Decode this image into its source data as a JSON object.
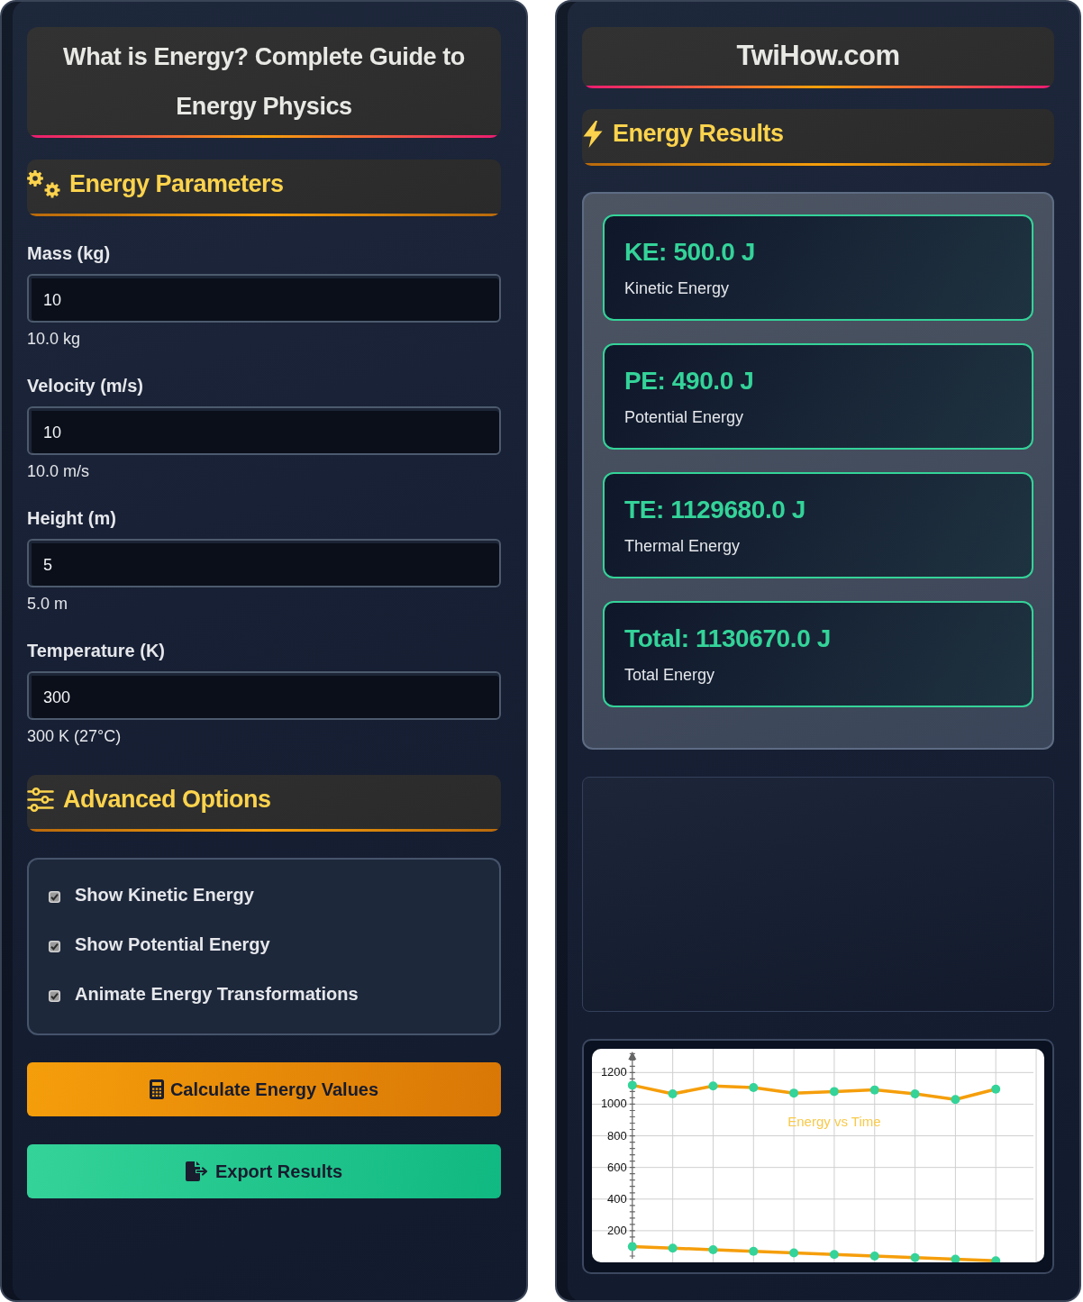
{
  "left_panel": {
    "title": "What is Energy? Complete Guide to Energy Physics",
    "parameters": {
      "heading": "Energy Parameters",
      "fields": [
        {
          "label": "Mass (kg)",
          "value": "10",
          "reading": "10.0 kg"
        },
        {
          "label": "Velocity (m/s)",
          "value": "10",
          "reading": "10.0 m/s"
        },
        {
          "label": "Height (m)",
          "value": "5",
          "reading": "5.0 m"
        },
        {
          "label": "Temperature (K)",
          "value": "300",
          "reading": "300 K (27°C)"
        }
      ]
    },
    "options": {
      "heading": "Advanced Options",
      "items": [
        {
          "label": "Show Kinetic Energy",
          "checked": true
        },
        {
          "label": "Show Potential Energy",
          "checked": true
        },
        {
          "label": "Animate Energy Transformations",
          "checked": true
        }
      ]
    },
    "buttons": [
      {
        "kind": "calculate",
        "label": "Calculate Energy Values"
      },
      {
        "kind": "export",
        "label": "Export Results"
      }
    ]
  },
  "right_panel": {
    "site_name": "TwiHow.com",
    "results": {
      "heading": "Energy Results",
      "cards": [
        {
          "value": "KE: 500.0 J",
          "label": "Kinetic Energy"
        },
        {
          "value": "PE: 490.0 J",
          "label": "Potential Energy"
        },
        {
          "value": "TE: 1129680.0 J",
          "label": "Thermal Energy"
        },
        {
          "value": "Total: 1130670.0 J",
          "label": "Total Energy"
        }
      ]
    },
    "chart": {
      "chart_data": {
        "type": "line",
        "title": "Energy vs Time",
        "categories": [
          null,
          null,
          null,
          null,
          null,
          null,
          null,
          null,
          null,
          null
        ],
        "series": [
          {
            "color": "#f59e0b",
            "marker": "circle",
            "values": [
              1120,
              1065,
              1115,
              1105,
              1070,
              1080,
              1090,
              1065,
              1030,
              1095
            ]
          },
          {
            "color": "#f59e0b",
            "marker": "circle",
            "values": [
              100,
              90,
              80,
              70,
              60,
              50,
              40,
              30,
              20,
              10
            ]
          }
        ],
        "ylim": [
          0,
          1350
        ],
        "yticks": [
          200,
          400,
          600,
          800,
          1000,
          1200
        ],
        "grid": true
      }
    }
  }
}
